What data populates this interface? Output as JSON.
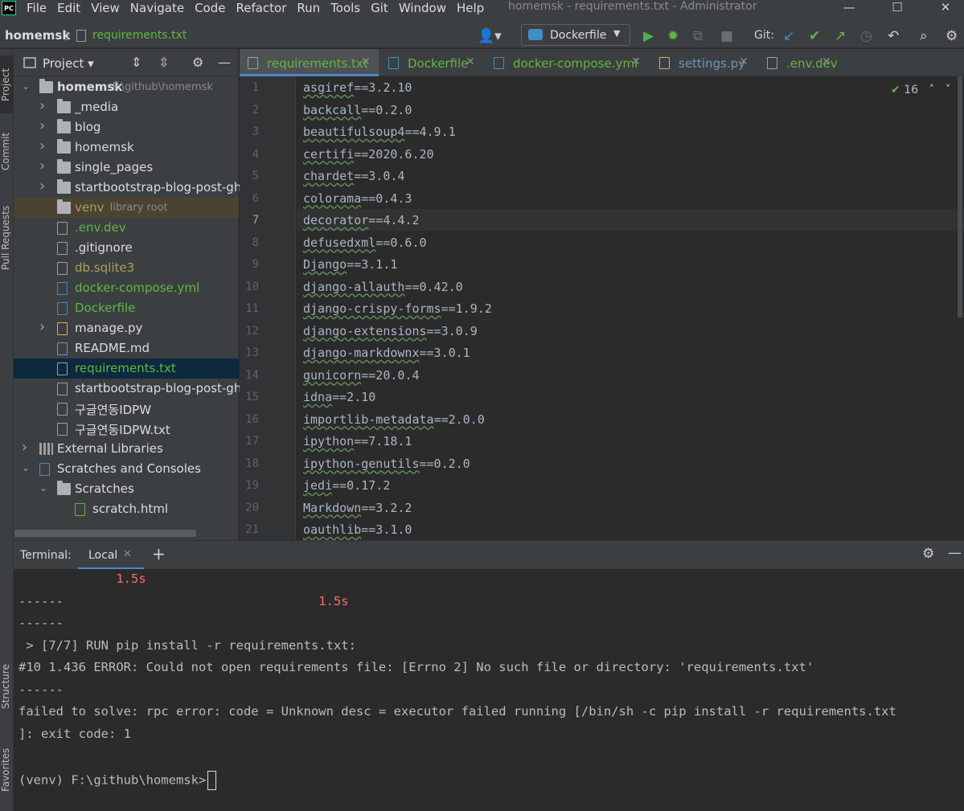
{
  "window": {
    "app_icon_text": "PC",
    "menu": [
      "File",
      "Edit",
      "View",
      "Navigate",
      "Code",
      "Refactor",
      "Run",
      "Tools",
      "Git",
      "Window",
      "Help"
    ],
    "title": "homemsk - requirements.txt - Administrator",
    "controls": {
      "minimize": "—",
      "maximize": "☐",
      "close": "✕"
    }
  },
  "navbar": {
    "project": "homemsk",
    "separator": "〉",
    "file": "requirements.txt",
    "run_config": "Dockerfile",
    "git_label": "Git:"
  },
  "left_stripe": {
    "project": "Project",
    "commit": "Commit",
    "pull_requests": "Pull Requests",
    "structure": "Structure",
    "favorites": "Favorites"
  },
  "project_panel": {
    "title": "Project",
    "tree": [
      {
        "name": "homemsk",
        "meta": "F:\\github\\homemsk",
        "type": "folder",
        "depth": 0,
        "expanded": true,
        "bold": true
      },
      {
        "name": "_media",
        "type": "folder",
        "depth": 1
      },
      {
        "name": "blog",
        "type": "folder",
        "depth": 1
      },
      {
        "name": "homemsk",
        "type": "folder",
        "depth": 1
      },
      {
        "name": "single_pages",
        "type": "folder",
        "depth": 1
      },
      {
        "name": "startbootstrap-blog-post-gh-p",
        "type": "folder",
        "depth": 1
      },
      {
        "name": "venv",
        "meta": "library root",
        "type": "folder",
        "depth": 1,
        "color": "#a8a058"
      },
      {
        "name": ".env.dev",
        "type": "file",
        "depth": 1,
        "color": "#62b543"
      },
      {
        "name": ".gitignore",
        "type": "file",
        "depth": 1
      },
      {
        "name": "db.sqlite3",
        "type": "file",
        "depth": 1,
        "color": "#a8a058"
      },
      {
        "name": "docker-compose.yml",
        "type": "dc",
        "depth": 1,
        "color": "#62b543"
      },
      {
        "name": "Dockerfile",
        "type": "docker",
        "depth": 1,
        "color": "#62b543"
      },
      {
        "name": "manage.py",
        "type": "py",
        "depth": 1
      },
      {
        "name": "README.md",
        "type": "md",
        "depth": 1
      },
      {
        "name": "requirements.txt",
        "type": "file",
        "depth": 1,
        "color": "#62b543",
        "selected": true
      },
      {
        "name": "startbootstrap-blog-post-gh-p",
        "type": "zip",
        "depth": 1
      },
      {
        "name": "구글연동IDPW",
        "type": "file",
        "depth": 1
      },
      {
        "name": "구글연동IDPW.txt",
        "type": "file",
        "depth": 1
      },
      {
        "name": "External Libraries",
        "type": "lib",
        "depth": 0
      },
      {
        "name": "Scratches and Consoles",
        "type": "scratch",
        "depth": 0,
        "expanded": true
      },
      {
        "name": "Scratches",
        "type": "folder",
        "depth": 1,
        "expanded": true
      },
      {
        "name": "scratch.html",
        "type": "html",
        "depth": 2
      }
    ]
  },
  "editor_tabs": [
    {
      "label": "requirements.txt",
      "active": true,
      "color": "#62b543"
    },
    {
      "label": "Dockerfile",
      "color": "#62b543"
    },
    {
      "label": "docker-compose.yml",
      "color": "#62b543"
    },
    {
      "label": "settings.py",
      "color": "#6897bb"
    },
    {
      "label": ".env.dev",
      "color": "#62b543"
    }
  ],
  "editor": {
    "inspection_count": "16",
    "lines": [
      {
        "n": "1",
        "pkg": "asgiref",
        "ver": "==3.2.10"
      },
      {
        "n": "2",
        "pkg": "backcall",
        "ver": "==0.2.0"
      },
      {
        "n": "3",
        "pkg": "beautifulsoup4",
        "ver": "==4.9.1"
      },
      {
        "n": "4",
        "pkg": "certifi",
        "ver": "==2020.6.20"
      },
      {
        "n": "5",
        "pkg": "chardet",
        "ver": "==3.0.4"
      },
      {
        "n": "6",
        "pkg": "colorama",
        "ver": "==0.4.3"
      },
      {
        "n": "7",
        "pkg": "decorator",
        "ver": "==4.4.2"
      },
      {
        "n": "8",
        "pkg": "defusedxml",
        "ver": "==0.6.0"
      },
      {
        "n": "9",
        "pkg": "Django",
        "ver": "==3.1.1"
      },
      {
        "n": "10",
        "pkg": "django-allauth",
        "ver": "==0.42.0"
      },
      {
        "n": "11",
        "pkg": "django-crispy-forms",
        "ver": "==1.9.2"
      },
      {
        "n": "12",
        "pkg": "django-extensions",
        "ver": "==3.0.9"
      },
      {
        "n": "13",
        "pkg": "django-markdownx",
        "ver": "==3.0.1"
      },
      {
        "n": "14",
        "pkg": "gunicorn",
        "ver": "==20.0.4"
      },
      {
        "n": "15",
        "pkg": "idna",
        "ver": "==2.10"
      },
      {
        "n": "16",
        "pkg": "importlib-metadata",
        "ver": "==2.0.0"
      },
      {
        "n": "17",
        "pkg": "ipython",
        "ver": "==7.18.1"
      },
      {
        "n": "18",
        "pkg": "ipython-genutils",
        "ver": "==0.2.0"
      },
      {
        "n": "19",
        "pkg": "jedi",
        "ver": "==0.17.2"
      },
      {
        "n": "20",
        "pkg": "Markdown",
        "ver": "==3.2.2"
      },
      {
        "n": "21",
        "pkg": "oauthlib",
        "ver": "==3.1.0"
      }
    ]
  },
  "terminal": {
    "label": "Terminal:",
    "tab": "Local",
    "lines": [
      {
        "text": "             ",
        "red": "1.5s"
      },
      {
        "text": "------                                  ",
        "red": "1.5s"
      },
      {
        "text": "------"
      },
      {
        "text": " > [7/7] RUN pip install -r requirements.txt:"
      },
      {
        "text": "#10 1.436 ERROR: Could not open requirements file: [Errno 2] No such file or directory: 'requirements.txt'"
      },
      {
        "text": "------"
      },
      {
        "text": "failed to solve: rpc error: code = Unknown desc = executor failed running [/bin/sh -c pip install -r requirements.txt"
      },
      {
        "text": "]: exit code: 1"
      },
      {
        "text": ""
      },
      {
        "text": "(venv) F:\\github\\homemsk>"
      }
    ]
  }
}
